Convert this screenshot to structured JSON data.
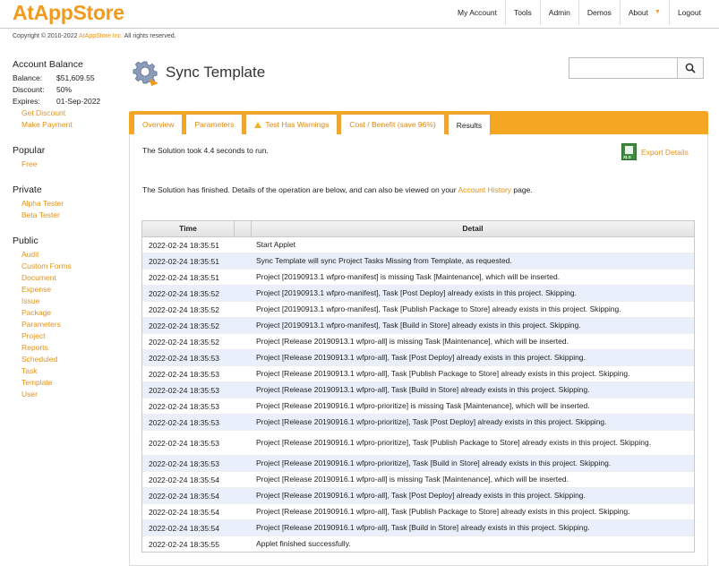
{
  "header": {
    "logo": "AtAppStore",
    "copyright_prefix": "Copyright © 2010-2022 ",
    "copyright_link": "AtAppStore Inc.",
    "copyright_suffix": " All rights reserved.",
    "nav": [
      "My Account",
      "Tools",
      "Admin",
      "Demos",
      "About",
      "Logout"
    ]
  },
  "sidebar": {
    "account_heading": "Account Balance",
    "balance_label": "Balance:",
    "balance_value": "$51,609.55",
    "discount_label": "Discount:",
    "discount_value": "50%",
    "expires_label": "Expires:",
    "expires_value": "01-Sep-2022",
    "account_links": [
      "Get Discount",
      "Make Payment"
    ],
    "popular_heading": "Popular",
    "popular_links": [
      "Free"
    ],
    "private_heading": "Private",
    "private_links": [
      "Alpha Tester",
      "Beta Tester"
    ],
    "public_heading": "Public",
    "public_links": [
      "Audit",
      "Custom Forms",
      "Document",
      "Expense",
      "Issue",
      "Package",
      "Parameters",
      "Project",
      "Reports",
      "Scheduled",
      "Task",
      "Template",
      "User"
    ]
  },
  "page": {
    "title": "Sync Template",
    "search_placeholder": ""
  },
  "tabs": [
    "Overview",
    "Parameters",
    "Test Has Warnings",
    "Cost / Benefit (save 96%)",
    "Results"
  ],
  "results": {
    "runtime": "The Solution took 4.4 seconds to run.",
    "export_label": "Export Details",
    "finished_prefix": "The Solution has finished. Details of the operation are below, and can also be viewed on your ",
    "finished_link": "Account History",
    "finished_suffix": " page."
  },
  "table": {
    "headers": [
      "Time",
      "Detail"
    ],
    "rows": [
      [
        "2022-02-24 18:35:51",
        "Start Applet"
      ],
      [
        "2022-02-24 18:35:51",
        "Sync Template will sync Project Tasks Missing from Template, as requested."
      ],
      [
        "2022-02-24 18:35:51",
        "Project [20190913.1 wfpro-manifest] is missing Task [Maintenance], which will be inserted."
      ],
      [
        "2022-02-24 18:35:52",
        "Project [20190913.1 wfpro-manifest], Task [Post Deploy] already exists in this project. Skipping."
      ],
      [
        "2022-02-24 18:35:52",
        "Project [20190913.1 wfpro-manifest], Task [Publish Package to Store] already exists in this project. Skipping."
      ],
      [
        "2022-02-24 18:35:52",
        "Project [20190913.1 wfpro-manifest], Task [Build in Store] already exists in this project. Skipping."
      ],
      [
        "2022-02-24 18:35:52",
        "Project [Release 20190913.1 wfpro-all] is missing Task [Maintenance], which will be inserted."
      ],
      [
        "2022-02-24 18:35:53",
        "Project [Release 20190913.1 wfpro-all], Task [Post Deploy] already exists in this project. Skipping."
      ],
      [
        "2022-02-24 18:35:53",
        "Project [Release 20190913.1 wfpro-all], Task [Publish Package to Store] already exists in this project. Skipping."
      ],
      [
        "2022-02-24 18:35:53",
        "Project [Release 20190913.1 wfpro-all], Task [Build in Store] already exists in this project. Skipping."
      ],
      [
        "2022-02-24 18:35:53",
        "Project [Release 20190916.1 wfpro-prioritize] is missing Task [Maintenance], which will be inserted."
      ],
      [
        "2022-02-24 18:35:53",
        "Project [Release 20190916.1 wfpro-prioritize], Task [Post Deploy] already exists in this project. Skipping."
      ],
      [
        "2022-02-24 18:35:53",
        "Project [Release 20190916.1 wfpro-prioritize], Task [Publish Package to Store] already exists in this project. Skipping."
      ],
      [
        "2022-02-24 18:35:53",
        "Project [Release 20190916.1 wfpro-prioritize], Task [Build in Store] already exists in this project. Skipping."
      ],
      [
        "2022-02-24 18:35:54",
        "Project [Release 20190916.1 wfpro-all] is missing Task [Maintenance], which will be inserted."
      ],
      [
        "2022-02-24 18:35:54",
        "Project [Release 20190916.1 wfpro-all], Task [Post Deploy] already exists in this project. Skipping."
      ],
      [
        "2022-02-24 18:35:54",
        "Project [Release 20190916.1 wfpro-all], Task [Publish Package to Store] already exists in this project. Skipping."
      ],
      [
        "2022-02-24 18:35:54",
        "Project [Release 20190916.1 wfpro-all], Task [Build in Store] already exists in this project. Skipping."
      ],
      [
        "2022-02-24 18:35:55",
        "Applet finished successfully."
      ]
    ]
  },
  "icons": {
    "page_icon": "gear-sync-icon",
    "search": "search-icon",
    "warning": "warning-icon",
    "export": "excel-file-icon",
    "about_caret": "caret-down-icon"
  },
  "colors": {
    "brand": "#f39a1e",
    "link": "#e69215",
    "tabbar": "#f5a623",
    "row_alt": "#eaf0fb"
  }
}
